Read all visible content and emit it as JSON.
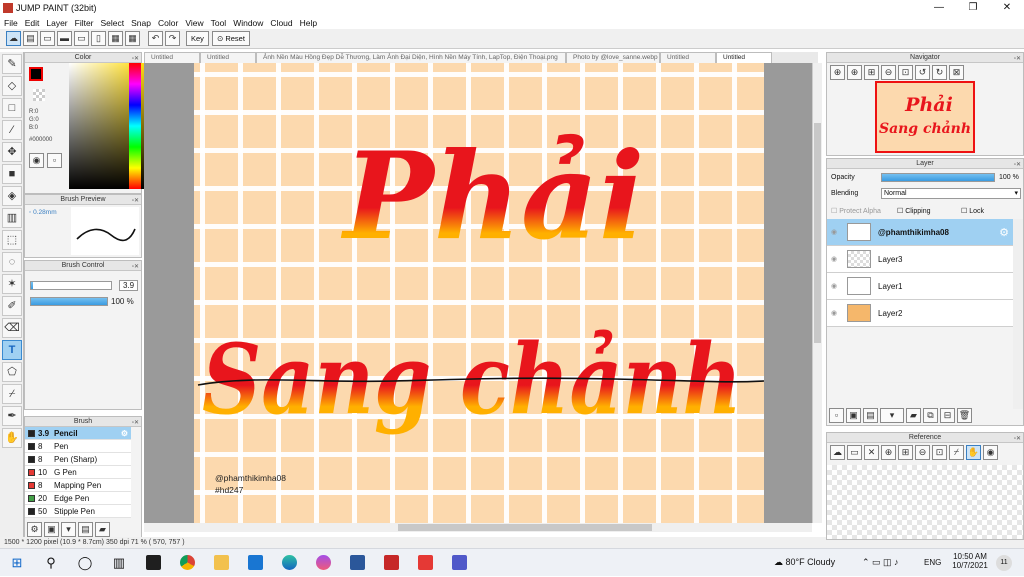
{
  "window": {
    "title": "JUMP PAINT (32bit)"
  },
  "menu": [
    "File",
    "Edit",
    "Layer",
    "Filter",
    "Select",
    "Snap",
    "Color",
    "View",
    "Tool",
    "Window",
    "Cloud",
    "Help"
  ],
  "toolbar": {
    "key_label": "Key",
    "reset_label": "Reset"
  },
  "panels": {
    "color": {
      "title": "Color",
      "r": "R:0",
      "g": "G:0",
      "b": "B:0",
      "hex": "#000000"
    },
    "brush_preview": {
      "title": "Brush Preview",
      "size": "0.28mm"
    },
    "brush_control": {
      "title": "Brush Control",
      "size_value": "3.9",
      "opacity_value": "100 %",
      "opacity_fraction": 1.0
    },
    "brush": {
      "title": "Brush",
      "items": [
        {
          "size": "3.9",
          "name": "Pencil",
          "color": "#222222",
          "selected": true
        },
        {
          "size": "8",
          "name": "Pen",
          "color": "#222222"
        },
        {
          "size": "8",
          "name": "Pen (Sharp)",
          "color": "#222222"
        },
        {
          "size": "10",
          "name": "G Pen",
          "color": "#e53935"
        },
        {
          "size": "8",
          "name": "Mapping Pen",
          "color": "#e53935"
        },
        {
          "size": "20",
          "name": "Edge Pen",
          "color": "#43a047"
        },
        {
          "size": "50",
          "name": "Stipple Pen",
          "color": "#222222"
        }
      ]
    },
    "navigator": {
      "title": "Navigator"
    },
    "layer": {
      "title": "Layer",
      "opacity_label": "Opacity",
      "opacity_value": "100 %",
      "blending_label": "Blending",
      "blending_value": "Normal",
      "protect_alpha": "Protect Alpha",
      "clipping": "Clipping",
      "lock": "Lock",
      "layers": [
        {
          "name": "@phamthikimha08",
          "selected": true
        },
        {
          "name": "Layer3"
        },
        {
          "name": "Layer1"
        },
        {
          "name": "Layer2"
        }
      ]
    },
    "reference": {
      "title": "Reference"
    }
  },
  "tabs": [
    {
      "label": "Untitled"
    },
    {
      "label": "Untitled"
    },
    {
      "label": "Ảnh Nền Màu Hồng Đẹp Dễ Thương, Làm Ảnh Đại Diện, Hình Nền Máy Tính, LapTop, Điện Thoại.png"
    },
    {
      "label": "Photo by @love_sanne.webp"
    },
    {
      "label": "Untitled"
    },
    {
      "label": "Untitled",
      "selected": true
    }
  ],
  "canvas": {
    "line1": "Phải",
    "line2": "Sang chảnh",
    "watermark_handle": "@phamthikimha08",
    "watermark_tag": "#hd247"
  },
  "status": {
    "text": "1500 * 1200 pixel   (10.9 * 8.7cm)   350 dpi   71 %   ( 570, 757 )"
  },
  "taskbar": {
    "weather": "80°F  Cloudy",
    "lang": "ENG",
    "time": "10:50 AM",
    "date": "10/7/2021",
    "notif_count": "11"
  },
  "colors": {
    "accent": "#3b9be0",
    "selection": "#9fd0f2",
    "text_red": "#e8151c",
    "text_orange": "#ffb000",
    "canvas_bg": "#fcd9ae"
  }
}
